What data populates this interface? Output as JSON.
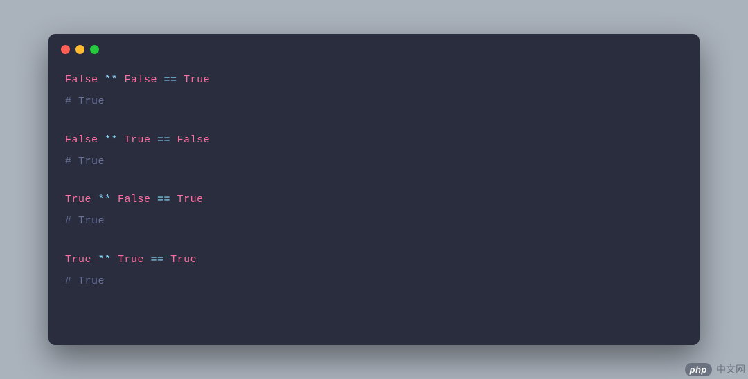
{
  "code": {
    "blocks": [
      {
        "lhs1": "False",
        "op1": " ** ",
        "lhs2": "False",
        "op2": " == ",
        "rhs": "True",
        "comment": "# True"
      },
      {
        "lhs1": "False",
        "op1": " ** ",
        "lhs2": "True",
        "op2": " == ",
        "rhs": "False",
        "comment": "# True"
      },
      {
        "lhs1": "True",
        "op1": " ** ",
        "lhs2": "False",
        "op2": " == ",
        "rhs": "True",
        "comment": "# True"
      },
      {
        "lhs1": "True",
        "op1": " ** ",
        "lhs2": "True",
        "op2": " == ",
        "rhs": "True",
        "comment": "# True"
      }
    ]
  },
  "watermark": {
    "badge": "php",
    "text": "中文网"
  }
}
